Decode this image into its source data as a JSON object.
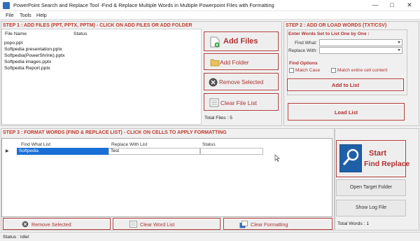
{
  "window": {
    "title": "PowerPoint Search and Replace Tool -Find & Replace Multiple Words in Multiple Powerpoint Files with Formatting",
    "icon": "app-icon",
    "controls": [
      "—",
      "□",
      "✕"
    ]
  },
  "menu": [
    "File",
    "Tools",
    "Help"
  ],
  "step1": {
    "header": "STEP 1 : ADD FILES (PPT, PPTX, PPTM) - CLICK ON ADD FILES OR ADD FOLDER",
    "columns": [
      "File Name",
      "Status"
    ],
    "files": [
      {
        "name": "popo.ppt"
      },
      {
        "name": "Softpedia presentation.pptx"
      },
      {
        "name": "Softpedia(PowerShrink).pptx"
      },
      {
        "name": "Softpedia images.pptx"
      },
      {
        "name": "Softpedia Report.pptx"
      }
    ],
    "buttons": {
      "add_files": "Add Files",
      "add_folder": "Add Folder",
      "remove_selected": "Remove Selected",
      "clear_file_list": "Clear File List"
    },
    "total_files": "Total Files : 5"
  },
  "step2": {
    "header": "STEP 2 : ADD OR LOAD WORDS (TXT/CSV)",
    "enter_words_label": "Enter Words Set to List One by One :",
    "find_what_label": "Find What:",
    "replace_with_label": "Replace With:",
    "find_what_value": "",
    "replace_with_value": "",
    "find_options_label": "Find Options",
    "match_case_label": "Match Case",
    "match_entire_label": "Match entire cell content",
    "add_to_list": "Add to List",
    "load_list": "Load List"
  },
  "step3": {
    "header": "STEP 3 : FORMAT WORDS (FIND & REPLACE LIST) - CLICK ON CELLS TO APPLY FORMATTING",
    "columns": [
      "Find What List",
      "Replace With List",
      "Status"
    ],
    "rows": [
      {
        "find": "Softpedia",
        "replace": "Test",
        "status": ""
      }
    ],
    "remove_selected": "Remove Selected",
    "clear_word_list": "Clear Word List",
    "clear_formatting": "Clear Formatting"
  },
  "actions": {
    "start_line1": "Start",
    "start_line2": "Find Replace",
    "open_target_folder": "Open Target Folder",
    "show_log_file": "Show Log File",
    "total_words": "Total Words : 1"
  },
  "status": "Status : Idle!",
  "colors": {
    "accent_red": "#c0392b",
    "selection_blue": "#1a6fd6",
    "start_icon_blue": "#1f5fa8"
  }
}
